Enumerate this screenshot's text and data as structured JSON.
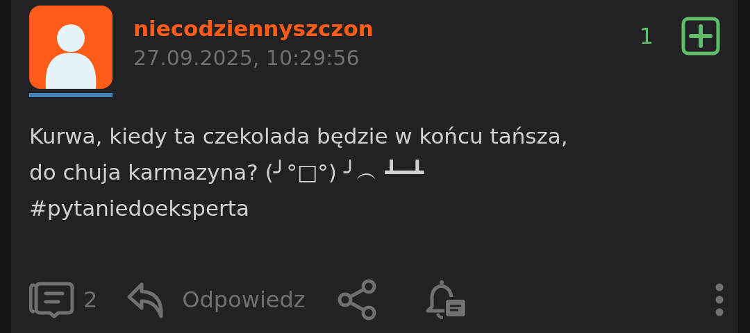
{
  "post": {
    "author": "niecodziennyszczon",
    "timestamp": "27.09.2025, 10:29:56",
    "votes": "1",
    "body": [
      "Kurwa, kiedy ta czekolada będzie w końcu tańsza,",
      "do chuja karmazyna? (╯°□°) ╯︵ ┻━┻",
      "#pytaniedoeksperta"
    ]
  },
  "actions": {
    "comments": "2",
    "reply": "Odpowiedz"
  }
}
